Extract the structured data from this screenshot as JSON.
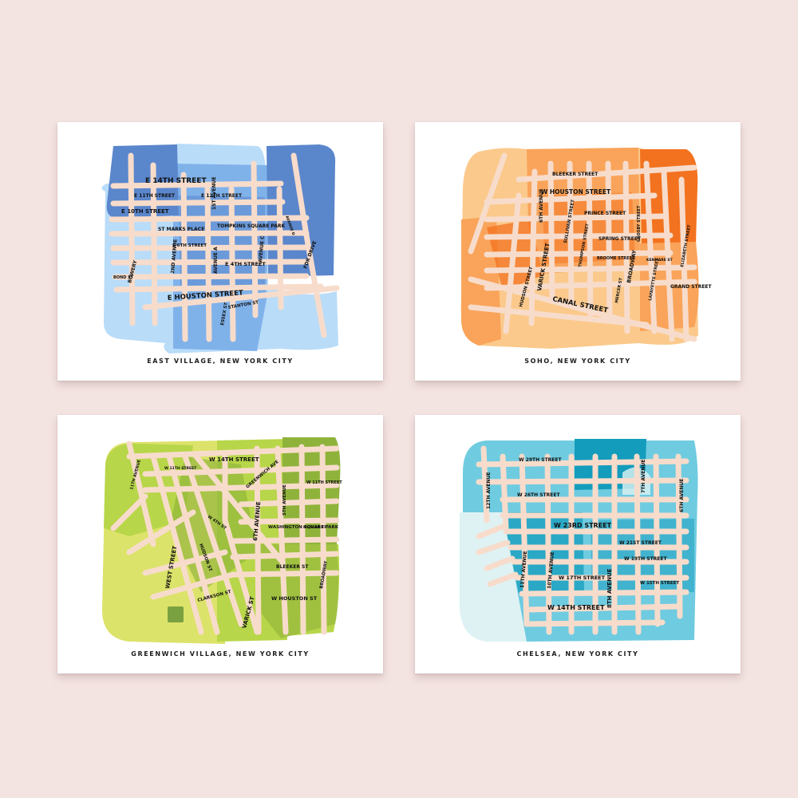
{
  "prints": [
    {
      "caption": "EAST VILLAGE, NEW YORK CITY",
      "palette": {
        "base": [
          "#5a86cc",
          "#80b2ea",
          "#b9dcf8"
        ],
        "roads": "#f7dccb"
      },
      "labels": [
        {
          "text": "E 14TH STREET"
        },
        {
          "text": "E 11TH STREET"
        },
        {
          "text": "E 10TH STREET"
        },
        {
          "text": "E 12TH STREET"
        },
        {
          "text": "1ST AVENUE"
        },
        {
          "text": "ST MARKS PLACE"
        },
        {
          "text": "TOMPKINS SQUARE PARK"
        },
        {
          "text": "E 6TH STREET"
        },
        {
          "text": "2ND AVENUE"
        },
        {
          "text": "AVENUE A"
        },
        {
          "text": "AVENUE C"
        },
        {
          "text": "E 4TH STREET"
        },
        {
          "text": "BOWERY"
        },
        {
          "text": "BOND ST"
        },
        {
          "text": "E HOUSTON STREET"
        },
        {
          "text": "ESSEX ST"
        },
        {
          "text": "STANTON ST"
        },
        {
          "text": "AVENUE D"
        },
        {
          "text": "FDR DRIVE"
        }
      ]
    },
    {
      "caption": "SOHO, NEW YORK CITY",
      "palette": {
        "base": [
          "#f3721f",
          "#f9a45a",
          "#fbc98b"
        ],
        "roads": "#f7dccb"
      },
      "labels": [
        {
          "text": "BLEEKER STREET"
        },
        {
          "text": "W HOUSTON STREET"
        },
        {
          "text": "6TH AVENUE"
        },
        {
          "text": "PRINCE STREET"
        },
        {
          "text": "SULLIVAN STREET"
        },
        {
          "text": "THOMPSON STREET"
        },
        {
          "text": "HUDSON STREET"
        },
        {
          "text": "VARICK STREET"
        },
        {
          "text": "SPRING STREET"
        },
        {
          "text": "CROSBY STREET"
        },
        {
          "text": "ELIZABETH STREET"
        },
        {
          "text": "BROOME STREET"
        },
        {
          "text": "BROADWAY"
        },
        {
          "text": "KENMARE ST"
        },
        {
          "text": "MERCER ST"
        },
        {
          "text": "LAFAYETTE STREET"
        },
        {
          "text": "GRAND STREET"
        },
        {
          "text": "CANAL STREET"
        }
      ]
    },
    {
      "caption": "GREENWICH VILLAGE, NEW YORK CITY",
      "palette": {
        "base": [
          "#8fb33a",
          "#b8d649",
          "#dce36a"
        ],
        "roads": "#f7dccb"
      },
      "labels": [
        {
          "text": "W 14TH STREET"
        },
        {
          "text": "11TH AVENUE"
        },
        {
          "text": "W 11TH STREET"
        },
        {
          "text": "GREENWICH AVE"
        },
        {
          "text": "W 11TH STREET"
        },
        {
          "text": "5TH AVENUE"
        },
        {
          "text": "W 4TH ST"
        },
        {
          "text": "6TH AVENUE"
        },
        {
          "text": "WASHINGTON SQUARE PARK"
        },
        {
          "text": "MERCER ST"
        },
        {
          "text": "HUDSON ST"
        },
        {
          "text": "WEST STREET"
        },
        {
          "text": "BROADWAY"
        },
        {
          "text": "BLEEKER ST"
        },
        {
          "text": "W HOUSTON ST"
        },
        {
          "text": "CLARKSON ST"
        },
        {
          "text": "VARICK ST"
        }
      ]
    },
    {
      "caption": "CHELSEA, NEW YORK CITY",
      "palette": {
        "base": [
          "#139cbc",
          "#6fcbe0",
          "#def2f4"
        ],
        "roads": "#f7dccb"
      },
      "labels": [
        {
          "text": "W 29TH STREET"
        },
        {
          "text": "12TH AVENUE"
        },
        {
          "text": "W 26TH STREET"
        },
        {
          "text": "7TH AVENUE"
        },
        {
          "text": "6TH AVENUE"
        },
        {
          "text": "W 23RD STREET"
        },
        {
          "text": "W 21ST STREET"
        },
        {
          "text": "11TH AVENUE"
        },
        {
          "text": "10TH AVENUE"
        },
        {
          "text": "W 19TH STREET"
        },
        {
          "text": "W 17TH STREET"
        },
        {
          "text": "8TH AVENUE"
        },
        {
          "text": "W 15TH STREET"
        },
        {
          "text": "W 14TH STREET"
        }
      ]
    }
  ]
}
